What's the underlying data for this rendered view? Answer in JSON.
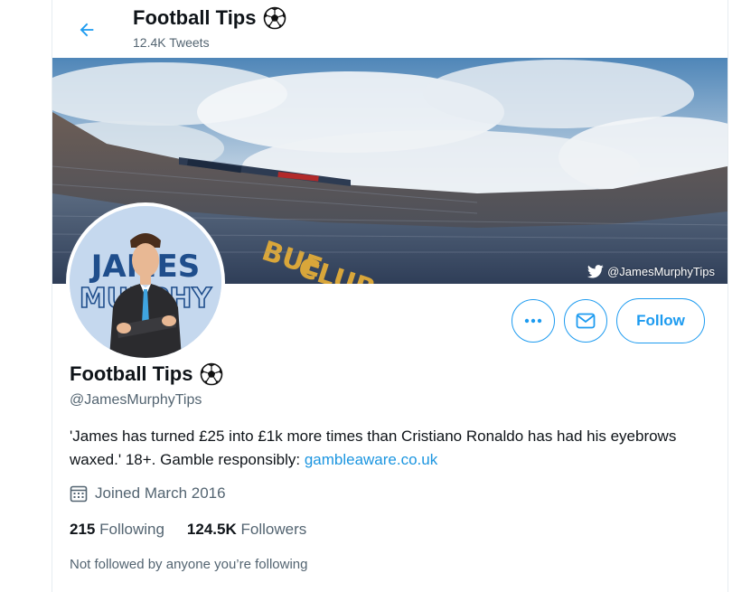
{
  "header": {
    "title": "Football Tips",
    "tweet_count": "12.4K Tweets"
  },
  "banner": {
    "watermark": "@JamesMurphyTips"
  },
  "avatar": {
    "line1": "JAMES",
    "line2": "MURPHY"
  },
  "actions": {
    "follow_label": "Follow"
  },
  "profile": {
    "name": "Football Tips",
    "handle": "@JamesMurphyTips",
    "bio_text": "'James has turned £25 into £1k more times than Cristiano Ronaldo has had his eyebrows waxed.' 18+. Gamble responsibly: ",
    "bio_link": "gambleaware.co.uk",
    "joined": "Joined March 2016",
    "following_count": "215",
    "following_label": "Following",
    "followers_count": "124.5K",
    "followers_label": "Followers",
    "not_followed": "Not followed by anyone you’re following"
  },
  "colors": {
    "accent": "#1d9bf0",
    "link": "#1b95e0",
    "secondary_text": "#536471"
  }
}
